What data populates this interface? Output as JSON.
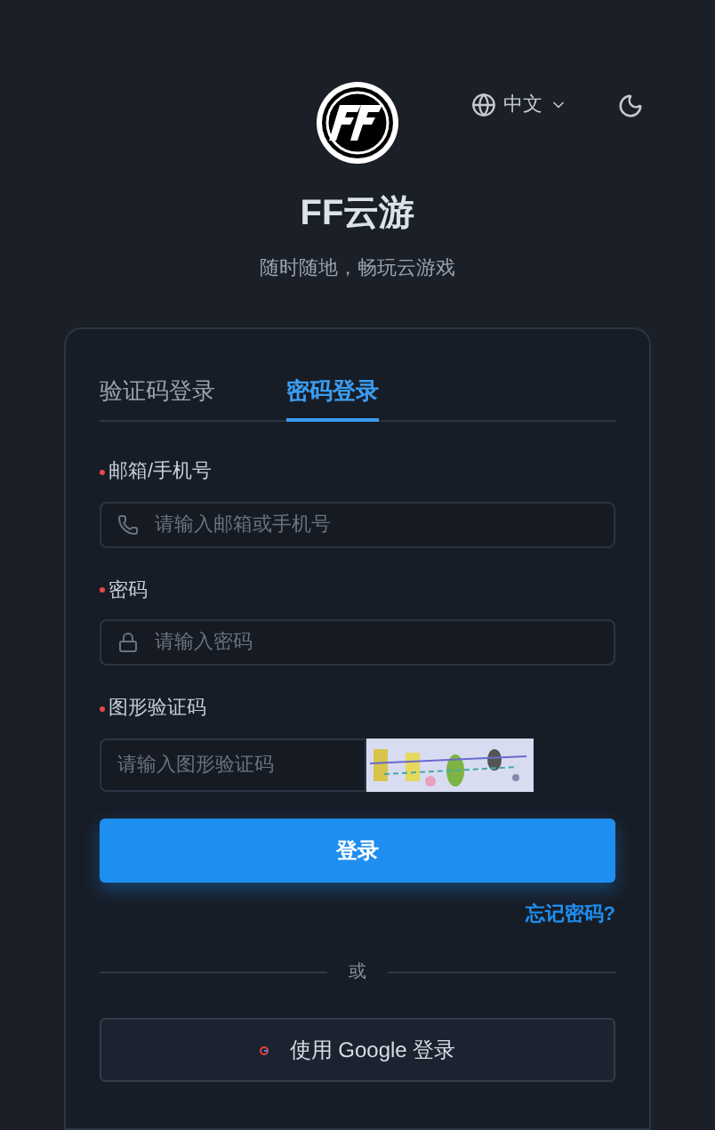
{
  "header": {
    "language": "中文",
    "title": "FF云游",
    "subtitle": "随时随地，畅玩云游戏"
  },
  "tabs": [
    {
      "label": "验证码登录",
      "selected": false
    },
    {
      "label": "密码登录",
      "selected": true
    }
  ],
  "fields": [
    {
      "label": "邮箱/手机号",
      "required": true,
      "placeholder": "请输入邮箱或手机号",
      "kind": "phone"
    },
    {
      "label": "密码",
      "required": true,
      "placeholder": "请输入密码",
      "kind": "lock"
    },
    {
      "label": "图形验证码",
      "required": true,
      "placeholder": "请输入图形验证码",
      "kind": "captcha"
    }
  ],
  "login_button": "登录",
  "forgot_link": "忘记密码?",
  "divider": "或",
  "google_button": "使用 Google 登录"
}
